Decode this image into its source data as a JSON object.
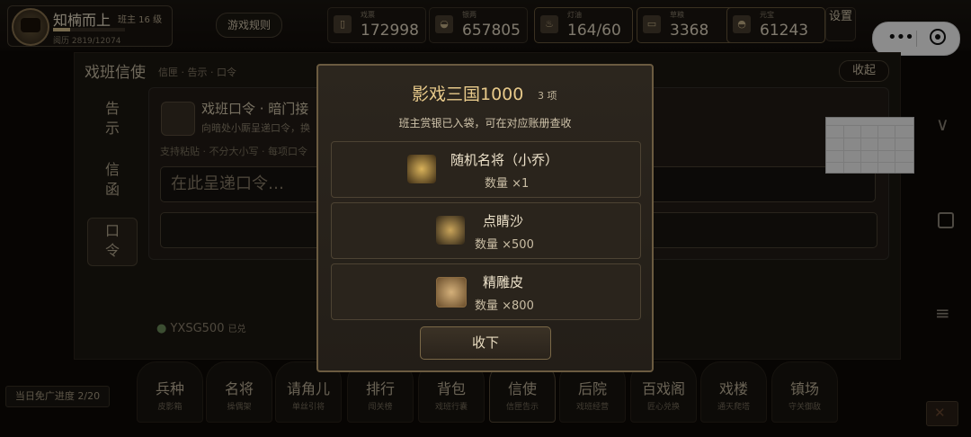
{
  "player": {
    "name": "知楠而上",
    "level": "班主 16 级",
    "xp_text": "阅历 2819/12074",
    "xp_fraction": 0.233
  },
  "header": {
    "rules_label": "游戏规则",
    "settings_label": "设置",
    "resources": [
      {
        "icon": "ticket-icon",
        "label": "戏票",
        "value": "172998"
      },
      {
        "icon": "silver-icon",
        "label": "银两",
        "value": "657805"
      },
      {
        "icon": "lamp-oil-icon",
        "label": "灯油",
        "value": "164/60"
      },
      {
        "icon": "grain-icon",
        "label": "草粮",
        "value": "3368"
      },
      {
        "icon": "ingot-icon",
        "label": "元宝",
        "value": "61243"
      }
    ]
  },
  "panel": {
    "title": "戏班信使",
    "subtitle": "信匣 · 告示 · 口令",
    "collapse_label": "收起",
    "tabs": [
      {
        "label": "告示",
        "active": false
      },
      {
        "label": "信函",
        "active": false
      },
      {
        "label": "口令",
        "active": true
      }
    ],
    "card_title": "戏班口令 · 暗门接",
    "card_subtitle": "向暗处小厮呈递口令，换",
    "hint": "支持粘贴 · 不分大小写 · 每项口令",
    "input_placeholder": "在此呈递口令…",
    "redeemed_code": "YXSG500",
    "redeemed_status": "已兑"
  },
  "bottom_nav": [
    {
      "label": "兵种",
      "sub": "皮影箱"
    },
    {
      "label": "名将",
      "sub": "操偶架"
    },
    {
      "label": "请角儿",
      "sub": "单丝引将"
    },
    {
      "label": "排行",
      "sub": "闯关榜"
    },
    {
      "label": "背包",
      "sub": "戏班行囊"
    },
    {
      "label": "信使",
      "sub": "信匣告示",
      "active": true
    },
    {
      "label": "后院",
      "sub": "戏班经营"
    },
    {
      "label": "百戏阁",
      "sub": "匠心兑换"
    },
    {
      "label": "戏楼",
      "sub": "通天爬塔"
    },
    {
      "label": "镇场",
      "sub": "守关御敌"
    }
  ],
  "daily_progress": "当日免广进度 2/20",
  "modal": {
    "title": "影戏三国1000",
    "count": "3 项",
    "message": "班主赏银已入袋，可在对应账册查收",
    "rewards": [
      {
        "icon": "general-portrait-icon",
        "name": "随机名将（小乔）",
        "qty": "数量 ×1"
      },
      {
        "icon": "sparkle-sand-icon",
        "name": "点睛沙",
        "qty": "数量 ×500"
      },
      {
        "icon": "leather-icon",
        "name": "精雕皮",
        "qty": "数量 ×800"
      }
    ],
    "confirm_label": "收下"
  },
  "colors": {
    "accent_gold": "#e7c98a",
    "background": "#0d0a07",
    "modal_border": "#6b5b40"
  }
}
